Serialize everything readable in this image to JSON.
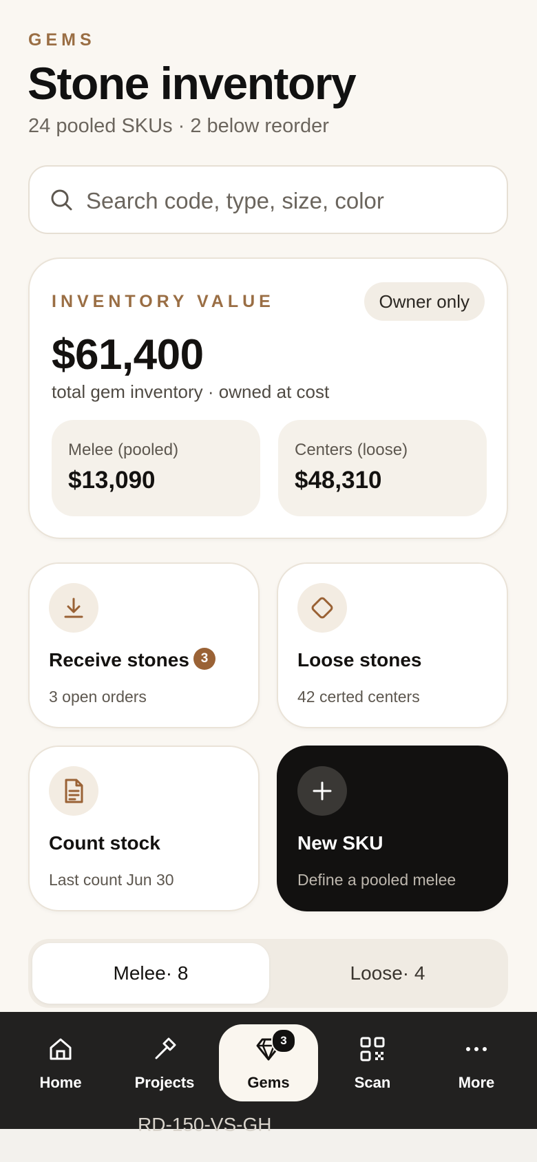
{
  "header": {
    "eyebrow": "GEMS",
    "title": "Stone inventory",
    "subtitle": "24 pooled SKUs · 2 below reorder"
  },
  "search": {
    "placeholder": "Search code, type, size, color",
    "value": ""
  },
  "inventory_value": {
    "label": "INVENTORY VALUE",
    "badge": "Owner only",
    "total": "$61,400",
    "note": "total gem inventory · owned at cost",
    "melee": {
      "label": "Melee (pooled)",
      "value": "$13,090"
    },
    "centers": {
      "label": "Centers (loose)",
      "value": "$48,310"
    }
  },
  "actions": {
    "receive": {
      "title": "Receive stones",
      "badge": "3",
      "subtitle": "3 open orders",
      "icon": "download-icon"
    },
    "loose": {
      "title": "Loose stones",
      "subtitle": "42 certed centers",
      "icon": "diamond-icon"
    },
    "count": {
      "title": "Count stock",
      "subtitle": "Last count Jun 30",
      "icon": "document-icon"
    },
    "new_sku": {
      "title": "New SKU",
      "subtitle": "Define a pooled melee",
      "icon": "plus-icon"
    }
  },
  "segments": {
    "melee": "Melee· 8",
    "loose": "Loose· 4"
  },
  "peek_row": "RD-150-VS-GH",
  "nav": {
    "home": "Home",
    "projects": "Projects",
    "gems": "Gems",
    "gems_badge": "3",
    "scan": "Scan",
    "more": "More"
  },
  "colors": {
    "accent": "#9A6E44",
    "background": "#FAF7F2",
    "nav_bar": "#222120",
    "dark_card": "#121110"
  }
}
